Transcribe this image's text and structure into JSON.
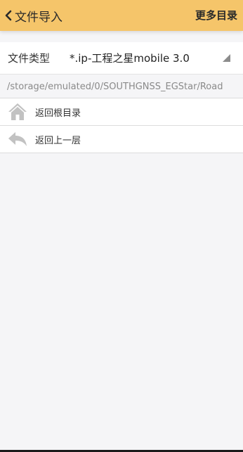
{
  "header": {
    "title": "文件导入",
    "more_label": "更多目录",
    "background_color": "#f5c56a"
  },
  "file_type": {
    "label": "文件类型",
    "selected_value": "*.ip-工程之星mobile 3.0"
  },
  "current_path": "/storage/emulated/0/SOUTHGNSS_EGStar/Road",
  "nav_items": [
    {
      "label": "返回根目录",
      "icon": "home-icon"
    },
    {
      "label": "返回上一层",
      "icon": "reply-arrow-icon"
    }
  ]
}
